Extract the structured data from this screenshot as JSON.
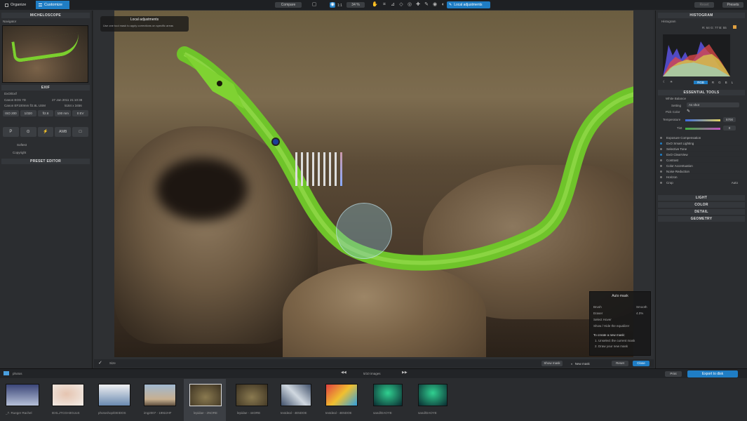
{
  "topbar": {
    "tabs": [
      "Organize",
      "Customize"
    ],
    "compare": "Compare",
    "zoom": "1:1",
    "zoom_percent": "34 %",
    "local_adjustments": "Local adjustments",
    "reset": "Reset",
    "presets": "Presets"
  },
  "left": {
    "navigator_title": "MICHELOSCOPE",
    "navigator_sub": "Navigator",
    "exif_title": "EXIF",
    "exif_subtitle": "DxO/Exif",
    "camera": "Canon EOS 7D",
    "date": "27 Jan 2011 21:10:38",
    "lens": "Canon EF100mm f/2.8L USM",
    "size": "5184 x 3456",
    "exif_values": [
      "ISO 200",
      "1/320",
      "f/2.8",
      "100 mm",
      "0 EV"
    ],
    "softest": "Softest",
    "copyright": "Copyright",
    "preset_editor": "PRESET EDITOR"
  },
  "tooltip": {
    "title": "Local adjustments",
    "body": "Use one tool mask to apply corrections on specific areas"
  },
  "autoMask": {
    "title": "Auto mask",
    "brush": "Brush",
    "eraser": "Eraser",
    "select_hover": "Select Hover",
    "show_hide": "Show / Hide the equalizer",
    "hint1": "To create a new mask:",
    "hint2": "1. Unselect the current mask",
    "hint3": "2. Draw your new mask",
    "size1": "Smooth",
    "size2": "4.0%"
  },
  "right": {
    "histogram_title": "HISTOGRAM",
    "histogram_sub": "Histogram",
    "hist_values": "R: 64 G: 77 B: 55",
    "channels": [
      "RGB",
      "R",
      "G",
      "B",
      "L"
    ],
    "tools_title": "ESSENTIAL TOOLS",
    "white_balance": "White Balance",
    "setting_label": "Setting",
    "setting_value": "As shot",
    "picker_label": "Pick Color",
    "temp_label": "Temperature",
    "temp_value": "5700",
    "tint_label": "Tint",
    "tint_value": "0",
    "tools": [
      "Exposure Compensation",
      "DxO Smart Lighting",
      "Selective Tone",
      "DxO ClearView",
      "Contrast",
      "Color Accentuation",
      "Noise Reduction",
      "Horizon",
      "Crop"
    ],
    "crop_value": "Auto",
    "sections": [
      "LIGHT",
      "COLOR",
      "DETAIL",
      "GEOMETRY"
    ]
  },
  "bottom_toolbar": {
    "size_label": "Size",
    "show_mask": "Show mask",
    "new_mask": "New mask",
    "reset": "Reset",
    "close": "Close"
  },
  "filmstrip_bar": {
    "folder": "photos",
    "count": "5/10 images",
    "print": "Print",
    "export": "Export to disk"
  },
  "filmstrip": [
    "_7. Rueger Rachel",
    "IEXLJTCGH3GUoS",
    "photoshop/DEIDOS",
    "img2007 - 1992JHF",
    "lepidae - 2NORE",
    "lepidae - 44ORE",
    "textdeal - 4E5DOE",
    "textdeal - 4E5DOE",
    "sand/DAOYE",
    "sand/DAOYE"
  ],
  "colors": {
    "accent": "#1f7dc4",
    "panel": "#2b2d30",
    "snake": "#6fc42a"
  }
}
